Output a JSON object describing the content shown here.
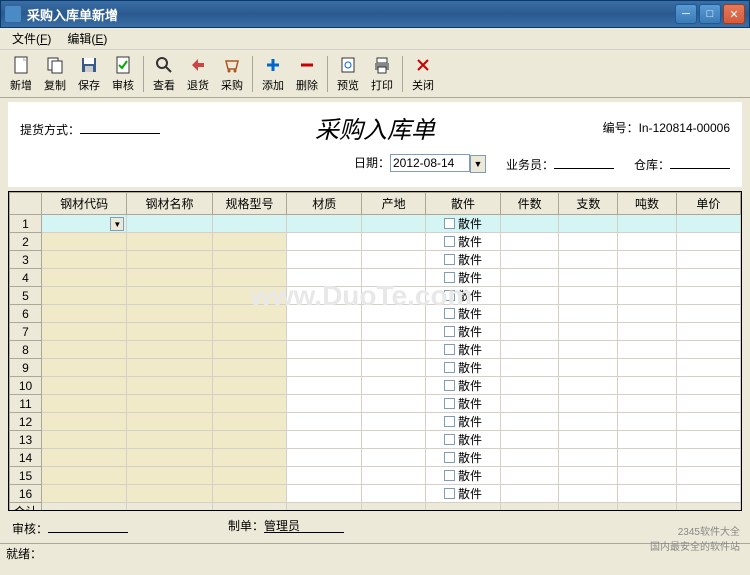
{
  "window": {
    "title": "采购入库单新增"
  },
  "menu": {
    "file": "文件",
    "file_hk": "F",
    "edit": "编辑",
    "edit_hk": "E"
  },
  "toolbar": {
    "new": "新增",
    "copy": "复制",
    "save": "保存",
    "audit": "审核",
    "view": "查看",
    "return": "退货",
    "purchase": "采购",
    "add": "添加",
    "delete": "删除",
    "preview": "预览",
    "print": "打印",
    "close": "关闭"
  },
  "form": {
    "pickup_label": "提货方式：",
    "title": "采购入库单",
    "docno_label": "编号：",
    "docno": "In-120814-00006",
    "date_label": "日期：",
    "date": "2012-08-14",
    "salesman_label": "业务员：",
    "warehouse_label": "仓库："
  },
  "grid": {
    "headers": [
      "钢材代码",
      "钢材名称",
      "规格型号",
      "材质",
      "产地",
      "散件",
      "件数",
      "支数",
      "吨数",
      "单价"
    ],
    "scatter_label": "散件",
    "sum_label": "合计",
    "row_count": 16
  },
  "footer": {
    "auditor_label": "审核：",
    "maker_label": "制单：",
    "maker": "管理员"
  },
  "status": {
    "ready": "就绪："
  },
  "watermark": "www.DuoTe.com",
  "corner": {
    "line1": "2345软件大全",
    "line2": "国内最安全的软件站"
  }
}
